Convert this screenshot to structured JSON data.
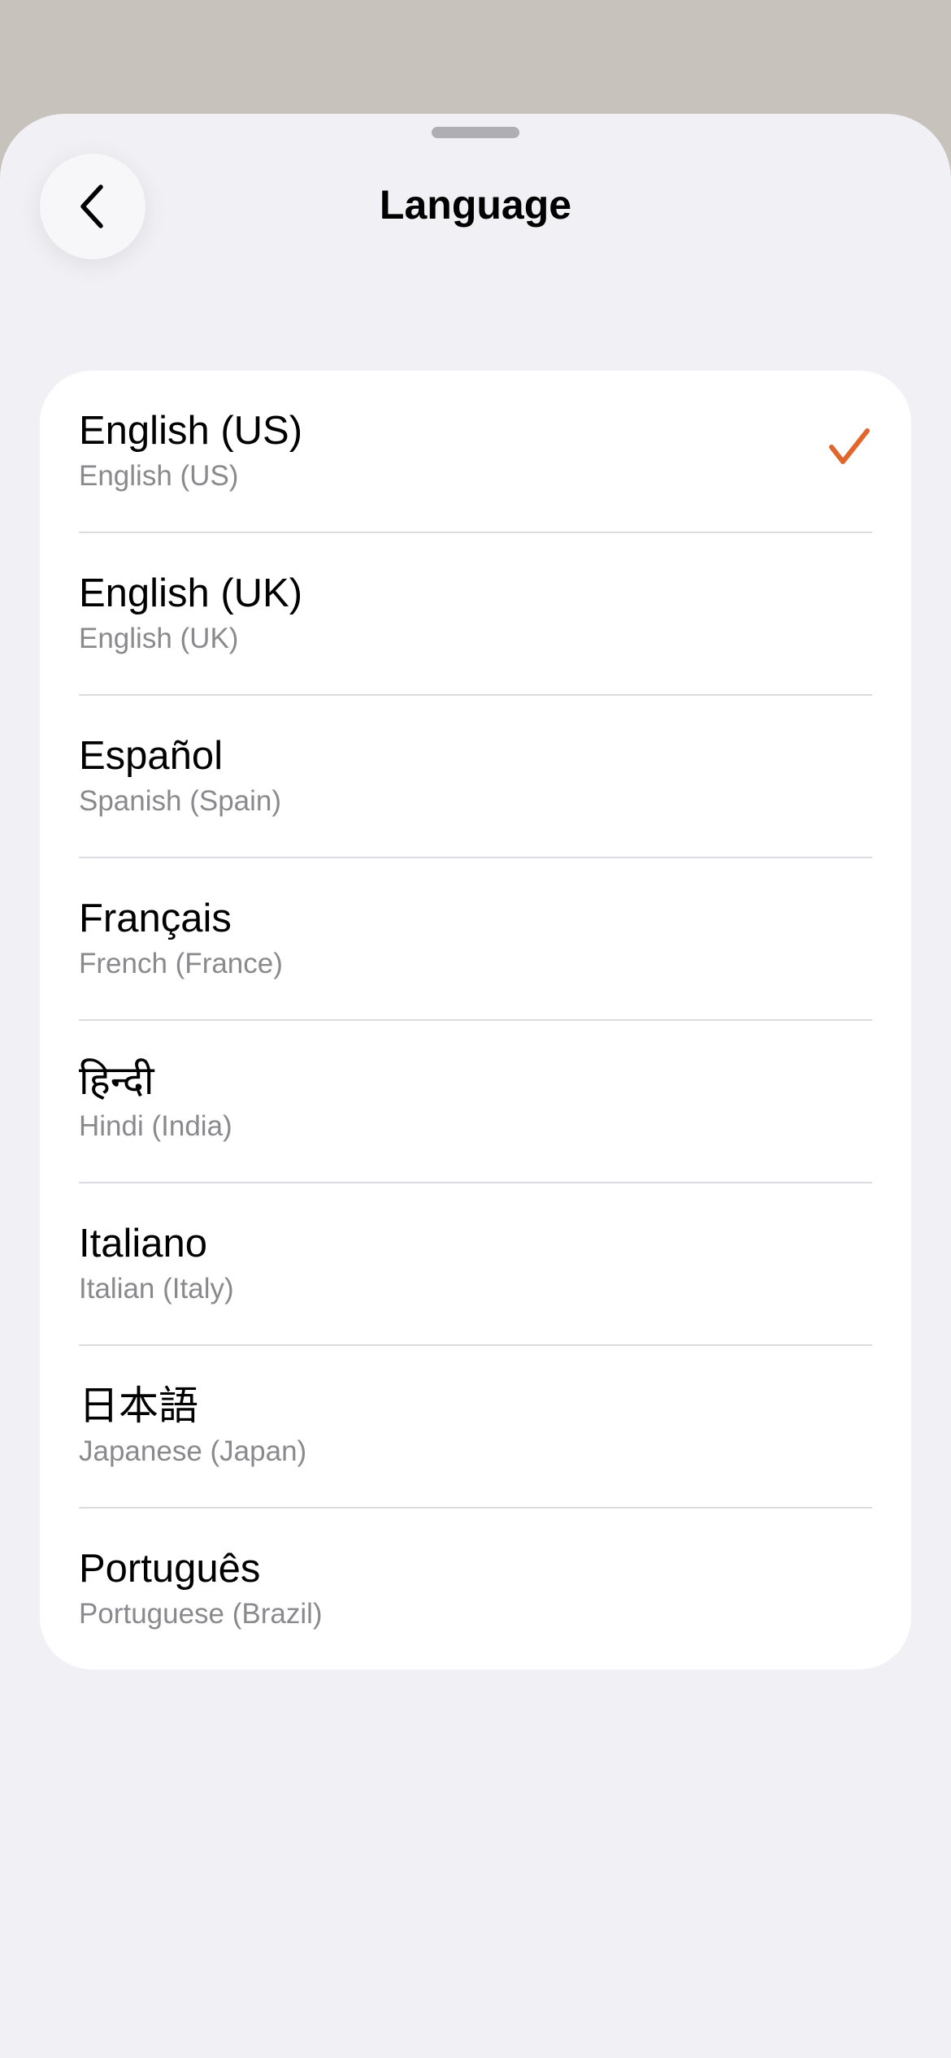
{
  "header": {
    "title": "Language",
    "back_icon": "chevron-left-icon"
  },
  "accent_color": "#e0662b",
  "languages": [
    {
      "name": "English (US)",
      "subtitle": "English (US)",
      "selected": true
    },
    {
      "name": "English (UK)",
      "subtitle": "English (UK)",
      "selected": false
    },
    {
      "name": "Español",
      "subtitle": "Spanish (Spain)",
      "selected": false
    },
    {
      "name": "Français",
      "subtitle": "French (France)",
      "selected": false
    },
    {
      "name": "हिन्दी",
      "subtitle": "Hindi (India)",
      "selected": false
    },
    {
      "name": "Italiano",
      "subtitle": "Italian (Italy)",
      "selected": false
    },
    {
      "name": "日本語",
      "subtitle": "Japanese (Japan)",
      "selected": false
    },
    {
      "name": "Português",
      "subtitle": "Portuguese (Brazil)",
      "selected": false
    }
  ]
}
